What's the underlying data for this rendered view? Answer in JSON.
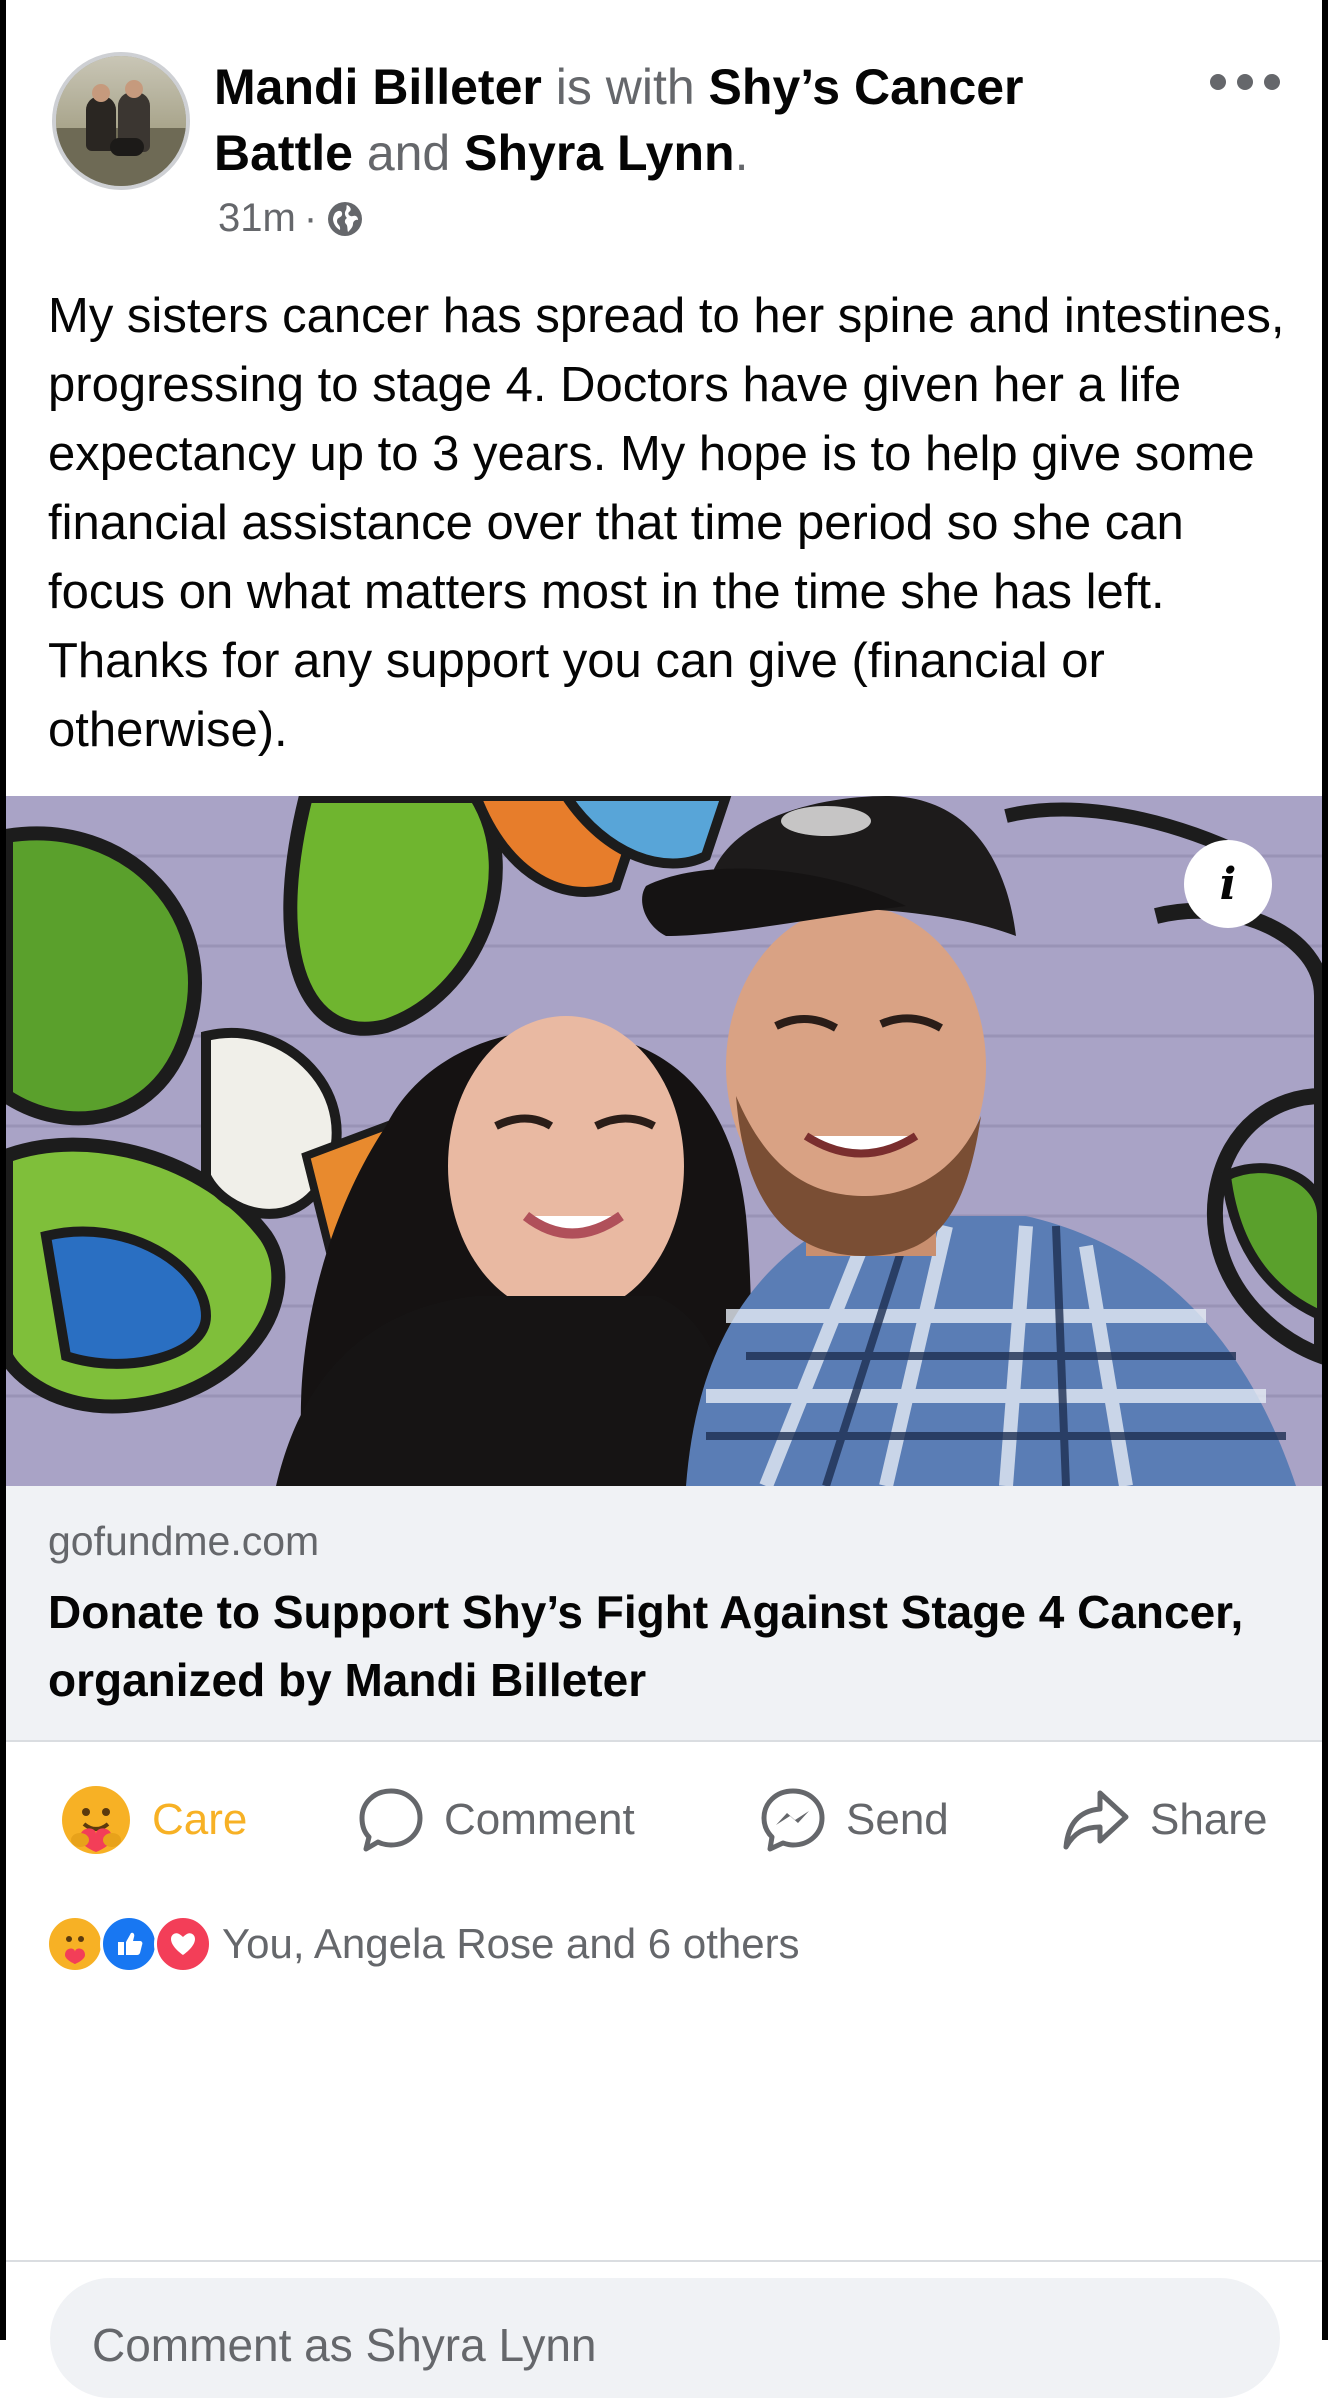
{
  "post": {
    "author": "Mandi Billeter",
    "with_text": " is with ",
    "tagged_1": "Shy’s Cancer Battle",
    "and_text": " and ",
    "tagged_2": "Shyra Lynn",
    "period": ".",
    "time": "31m",
    "dot": "·",
    "privacy_icon": "globe-icon",
    "text": "My sisters cancer has spread to her spine and intestines, progressing to stage 4. Doctors have given her a life expectancy up to 3 years. My hope is to help give some financial assistance over that time period so she can focus on what matters most in the time she has left. Thanks for any support you can give (financial or otherwise)."
  },
  "link_preview": {
    "domain": "gofundme.com",
    "title": "Donate to Support Shy’s Fight Against Stage 4 Cancer, organized by Mandi Billeter",
    "info_glyph": "i"
  },
  "actions": {
    "care": "Care",
    "comment": "Comment",
    "send": "Send",
    "share": "Share"
  },
  "reactions": {
    "summary": "You, Angela Rose and 6 others",
    "icons": [
      "care-icon",
      "like-icon",
      "love-icon"
    ]
  },
  "comment_input": {
    "placeholder": "Comment as Shyra Lynn"
  },
  "colors": {
    "care": "#f7b125",
    "like": "#1877f2",
    "love": "#f33e58",
    "secondary_text": "#65676b"
  }
}
